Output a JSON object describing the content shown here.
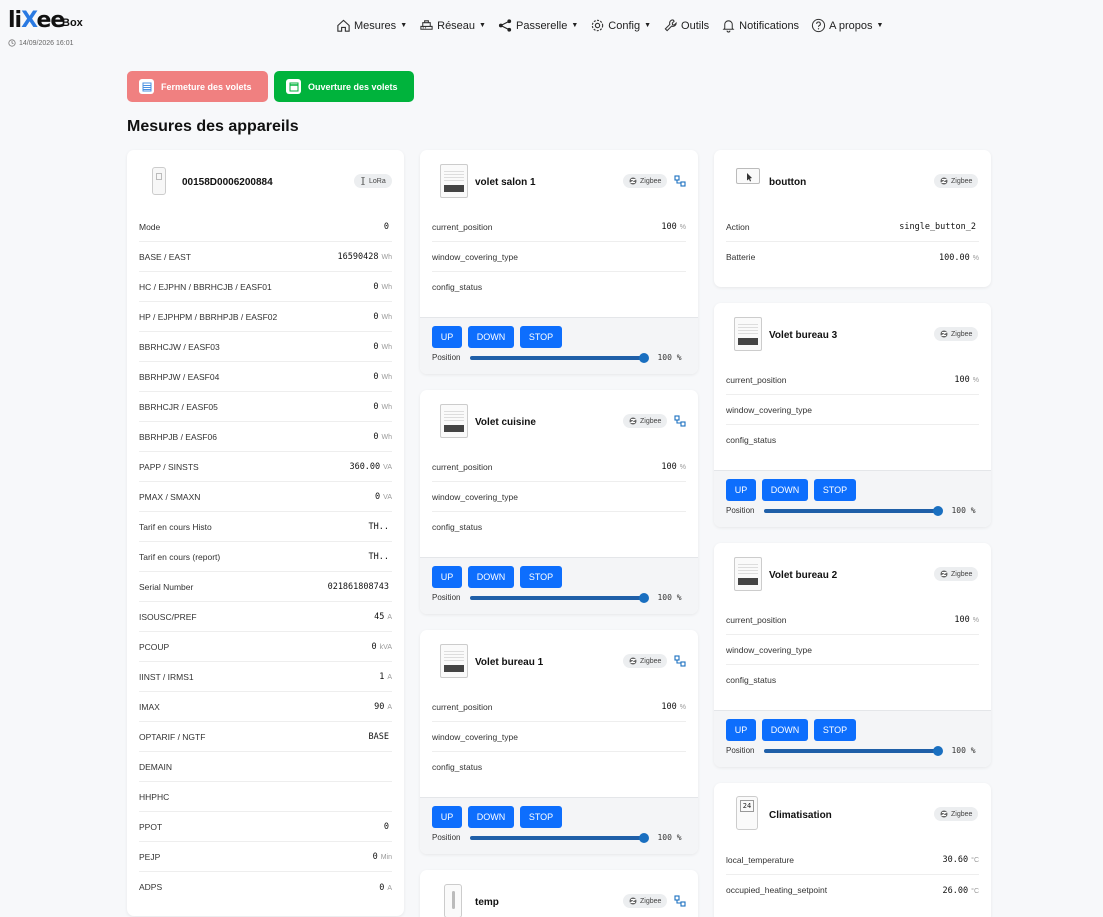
{
  "brand": {
    "logo_left": "li",
    "logo_x": "X",
    "logo_right": "ee",
    "box": "Box",
    "datetime": "14/09/2026 16:01"
  },
  "nav": [
    {
      "label": "Mesures",
      "icon": "home-icon",
      "caret": true
    },
    {
      "label": "Réseau",
      "icon": "network-icon",
      "caret": true
    },
    {
      "label": "Passerelle",
      "icon": "share-icon",
      "caret": true
    },
    {
      "label": "Config",
      "icon": "gear-icon",
      "caret": true
    },
    {
      "label": "Outils",
      "icon": "wrench-icon",
      "caret": false
    },
    {
      "label": "Notifications",
      "icon": "bell-icon",
      "caret": false
    },
    {
      "label": "A propos",
      "icon": "question-icon",
      "caret": true
    }
  ],
  "actions": {
    "close_label": "Fermeture des volets",
    "open_label": "Ouverture des volets"
  },
  "page_title": "Mesures des appareils",
  "lora": {
    "name": "00158D0006200884",
    "protocol": "LoRa",
    "rows": [
      {
        "label": "Mode",
        "value": "0",
        "unit": ""
      },
      {
        "label": "BASE / EAST",
        "value": "16590428",
        "unit": "Wh"
      },
      {
        "label": "HC / EJPHN / BBRHCJB / EASF01",
        "value": "0",
        "unit": "Wh"
      },
      {
        "label": "HP / EJPHPM / BBRHPJB / EASF02",
        "value": "0",
        "unit": "Wh"
      },
      {
        "label": "BBRHCJW / EASF03",
        "value": "0",
        "unit": "Wh"
      },
      {
        "label": "BBRHPJW / EASF04",
        "value": "0",
        "unit": "Wh"
      },
      {
        "label": "BBRHCJR / EASF05",
        "value": "0",
        "unit": "Wh"
      },
      {
        "label": "BBRHPJB / EASF06",
        "value": "0",
        "unit": "Wh"
      },
      {
        "label": "PAPP / SINSTS",
        "value": "360.00",
        "unit": "VA"
      },
      {
        "label": "PMAX / SMAXN",
        "value": "0",
        "unit": "VA"
      },
      {
        "label": "Tarif en cours Histo",
        "value": "TH..",
        "unit": ""
      },
      {
        "label": "Tarif en cours (report)",
        "value": "TH..",
        "unit": ""
      },
      {
        "label": "Serial Number",
        "value": "021861808743",
        "unit": ""
      },
      {
        "label": "ISOUSC/PREF",
        "value": "45",
        "unit": "A"
      },
      {
        "label": "PCOUP",
        "value": "0",
        "unit": "kVA"
      },
      {
        "label": "IINST / IRMS1",
        "value": "1",
        "unit": "A"
      },
      {
        "label": "IMAX",
        "value": "90",
        "unit": "A"
      },
      {
        "label": "OPTARIF / NGTF",
        "value": "BASE",
        "unit": ""
      },
      {
        "label": "DEMAIN",
        "value": "",
        "unit": ""
      },
      {
        "label": "HHPHC",
        "value": "",
        "unit": ""
      },
      {
        "label": "PPOT",
        "value": "0",
        "unit": ""
      },
      {
        "label": "PEJP",
        "value": "0",
        "unit": "Min"
      },
      {
        "label": "ADPS",
        "value": "0",
        "unit": "A"
      }
    ]
  },
  "controls": {
    "up": "UP",
    "down": "DOWN",
    "stop": "STOP",
    "position_label": "Position"
  },
  "shutters": [
    {
      "name": "volet salon 1",
      "protocol": "Zigbee",
      "position_pct": 100,
      "position_text": "100 %",
      "rows": [
        {
          "label": "current_position",
          "value": "100",
          "unit": "%"
        },
        {
          "label": "window_covering_type",
          "value": "",
          "unit": ""
        },
        {
          "label": "config_status",
          "value": "",
          "unit": ""
        }
      ]
    },
    {
      "name": "Volet cuisine",
      "protocol": "Zigbee",
      "position_pct": 100,
      "position_text": "100 %",
      "rows": [
        {
          "label": "current_position",
          "value": "100",
          "unit": "%"
        },
        {
          "label": "window_covering_type",
          "value": "",
          "unit": ""
        },
        {
          "label": "config_status",
          "value": "",
          "unit": ""
        }
      ]
    },
    {
      "name": "Volet bureau 1",
      "protocol": "Zigbee",
      "position_pct": 100,
      "position_text": "100 %",
      "rows": [
        {
          "label": "current_position",
          "value": "100",
          "unit": "%"
        },
        {
          "label": "window_covering_type",
          "value": "",
          "unit": ""
        },
        {
          "label": "config_status",
          "value": "",
          "unit": ""
        }
      ]
    },
    {
      "name": "Volet bureau 3",
      "protocol": "Zigbee",
      "position_pct": 100,
      "position_text": "100 %",
      "rows": [
        {
          "label": "current_position",
          "value": "100",
          "unit": "%"
        },
        {
          "label": "window_covering_type",
          "value": "",
          "unit": ""
        },
        {
          "label": "config_status",
          "value": "",
          "unit": ""
        }
      ]
    },
    {
      "name": "Volet bureau 2",
      "protocol": "Zigbee",
      "position_pct": 100,
      "position_text": "100 %",
      "rows": [
        {
          "label": "current_position",
          "value": "100",
          "unit": "%"
        },
        {
          "label": "window_covering_type",
          "value": "",
          "unit": ""
        },
        {
          "label": "config_status",
          "value": "",
          "unit": ""
        }
      ]
    }
  ],
  "temp": {
    "name": "temp",
    "protocol": "Zigbee"
  },
  "button_dev": {
    "name": "boutton",
    "protocol": "Zigbee",
    "rows": [
      {
        "label": "Action",
        "value": "single_button_2",
        "unit": ""
      },
      {
        "label": "Batterie",
        "value": "100.00",
        "unit": "%"
      }
    ]
  },
  "clim": {
    "name": "Climatisation",
    "protocol": "Zigbee",
    "display": "24",
    "rows": [
      {
        "label": "local_temperature",
        "value": "30.60",
        "unit": "°C"
      },
      {
        "label": "occupied_heating_setpoint",
        "value": "26.00",
        "unit": "°C"
      }
    ]
  }
}
